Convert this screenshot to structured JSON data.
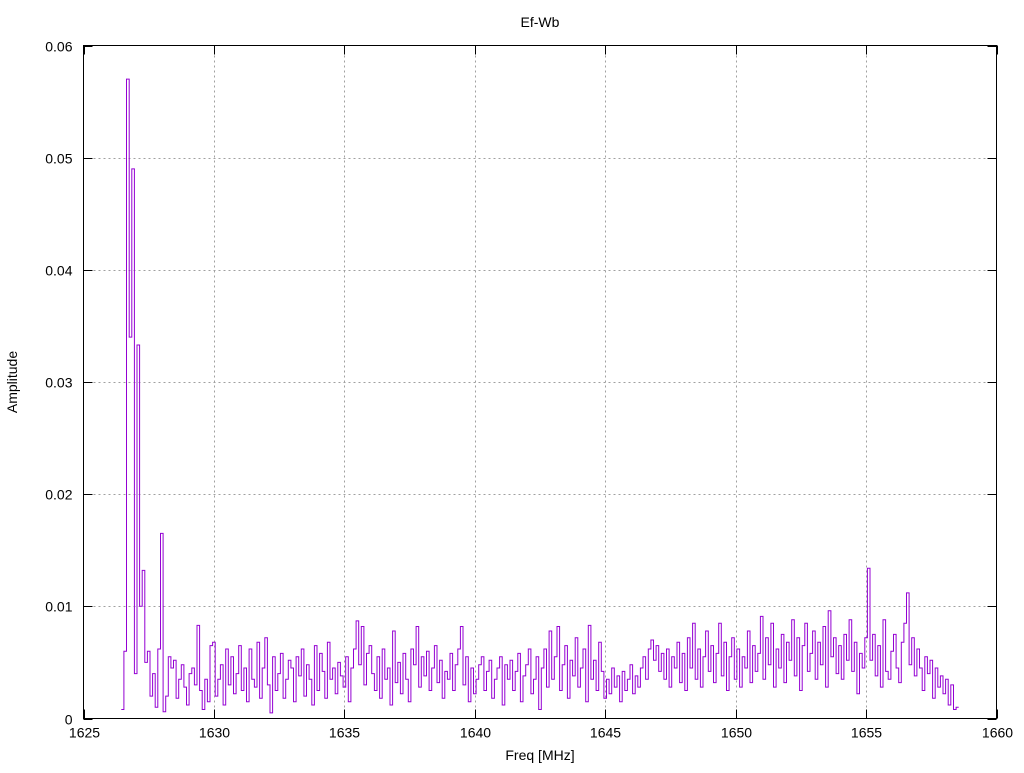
{
  "chart_data": {
    "type": "line",
    "title": "Ef-Wb",
    "xlabel": "Freq [MHz]",
    "ylabel": "Amplitude",
    "xlim": [
      1625,
      1660
    ],
    "ylim": [
      0,
      0.06
    ],
    "xticks": [
      "1625",
      "1630",
      "1635",
      "1640",
      "1645",
      "1650",
      "1655",
      "1660"
    ],
    "yticks": [
      "0",
      "0.01",
      "0.02",
      "0.03",
      "0.04",
      "0.05",
      "0.06"
    ],
    "grid": true,
    "line_color": "#9400d3",
    "series": [
      {
        "name": "Ef-Wb",
        "x_start": 1626.5,
        "x_step": 0.1,
        "values": [
          0.0008,
          0.006,
          0.057,
          0.034,
          0.049,
          0.004,
          0.0333,
          0.01,
          0.0132,
          0.005,
          0.006,
          0.002,
          0.004,
          0.001,
          0.0062,
          0.0165,
          0.0006,
          0.002,
          0.0055,
          0.0045,
          0.0052,
          0.0018,
          0.0035,
          0.0048,
          0.0028,
          0.0012,
          0.004,
          0.0045,
          0.003,
          0.0083,
          0.0025,
          0.0008,
          0.0035,
          0.0015,
          0.0065,
          0.0068,
          0.002,
          0.0035,
          0.0048,
          0.0012,
          0.0062,
          0.003,
          0.0055,
          0.0022,
          0.004,
          0.0065,
          0.0025,
          0.0045,
          0.0015,
          0.0062,
          0.0035,
          0.0028,
          0.0068,
          0.0018,
          0.0045,
          0.0072,
          0.003,
          0.0005,
          0.0055,
          0.0025,
          0.004,
          0.0058,
          0.0018,
          0.0035,
          0.0052,
          0.0045,
          0.0015,
          0.0055,
          0.0038,
          0.0062,
          0.002,
          0.0048,
          0.0035,
          0.0012,
          0.0065,
          0.0025,
          0.0058,
          0.0042,
          0.0018,
          0.0068,
          0.0035,
          0.0045,
          0.0022,
          0.005,
          0.0038,
          0.0028,
          0.0055,
          0.0015,
          0.0045,
          0.0062,
          0.0087,
          0.0048,
          0.0082,
          0.003,
          0.0058,
          0.0065,
          0.004,
          0.0025,
          0.0055,
          0.0018,
          0.0062,
          0.0035,
          0.0045,
          0.0012,
          0.0078,
          0.0032,
          0.005,
          0.0022,
          0.0058,
          0.0035,
          0.0015,
          0.0062,
          0.0048,
          0.0082,
          0.0028,
          0.0055,
          0.0038,
          0.006,
          0.0025,
          0.0045,
          0.0065,
          0.0032,
          0.0052,
          0.0018,
          0.0042,
          0.0035,
          0.0058,
          0.0025,
          0.0048,
          0.0062,
          0.0082,
          0.003,
          0.0055,
          0.0015,
          0.0045,
          0.0022,
          0.0035,
          0.0048,
          0.0055,
          0.0025,
          0.0042,
          0.0052,
          0.0018,
          0.0035,
          0.0045,
          0.0055,
          0.0012,
          0.0048,
          0.0035,
          0.0052,
          0.0025,
          0.0042,
          0.0058,
          0.0015,
          0.0038,
          0.0048,
          0.0062,
          0.0022,
          0.0035,
          0.0055,
          0.0008,
          0.0045,
          0.0062,
          0.0028,
          0.0078,
          0.0035,
          0.0055,
          0.0082,
          0.0025,
          0.0048,
          0.0065,
          0.0018,
          0.0052,
          0.0038,
          0.0072,
          0.0028,
          0.0045,
          0.0062,
          0.0015,
          0.0083,
          0.0035,
          0.0052,
          0.0025,
          0.0068,
          0.0042,
          0.0018,
          0.0035,
          0.0022,
          0.0045,
          0.0028,
          0.0038,
          0.0015,
          0.0042,
          0.0025,
          0.0035,
          0.0048,
          0.0022,
          0.0038,
          0.0028,
          0.0045,
          0.0055,
          0.0035,
          0.0062,
          0.007,
          0.0052,
          0.0065,
          0.0042,
          0.0058,
          0.0035,
          0.0062,
          0.0028,
          0.0055,
          0.0045,
          0.0068,
          0.0032,
          0.0058,
          0.0025,
          0.0072,
          0.0045,
          0.0085,
          0.0035,
          0.0062,
          0.0028,
          0.0055,
          0.0078,
          0.0042,
          0.0065,
          0.0032,
          0.0058,
          0.0085,
          0.0038,
          0.0068,
          0.0025,
          0.0055,
          0.0072,
          0.0035,
          0.0062,
          0.0028,
          0.0055,
          0.0045,
          0.0078,
          0.0032,
          0.0065,
          0.0042,
          0.0058,
          0.0091,
          0.0035,
          0.0072,
          0.0048,
          0.0085,
          0.0028,
          0.0062,
          0.0045,
          0.0075,
          0.0032,
          0.0068,
          0.0052,
          0.0088,
          0.0038,
          0.0072,
          0.0025,
          0.0065,
          0.0085,
          0.0042,
          0.0058,
          0.0078,
          0.0035,
          0.0068,
          0.0048,
          0.0082,
          0.0028,
          0.0096,
          0.0055,
          0.0072,
          0.004,
          0.0065,
          0.0035,
          0.0075,
          0.0052,
          0.0088,
          0.0042,
          0.0068,
          0.0022,
          0.0058,
          0.0045,
          0.0072,
          0.0134,
          0.0052,
          0.0075,
          0.0038,
          0.0065,
          0.0028,
          0.0088,
          0.0042,
          0.0035,
          0.006,
          0.0075,
          0.0045,
          0.0032,
          0.0068,
          0.0085,
          0.0112,
          0.0048,
          0.0072,
          0.0038,
          0.0062,
          0.0045,
          0.0025,
          0.0055,
          0.004,
          0.0052,
          0.0018,
          0.0045,
          0.0028,
          0.0038,
          0.0022,
          0.0035,
          0.0012,
          0.003,
          0.0008,
          0.001
        ]
      }
    ]
  }
}
